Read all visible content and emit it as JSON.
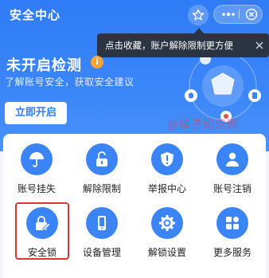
{
  "header": {
    "title": "安全中心",
    "star_icon": "star-outline-icon",
    "more_icon": "more-dots-icon",
    "close_icon": "close-circle-icon"
  },
  "tooltip": {
    "text": "点击收藏，账户解除限制更方便",
    "close_icon": "close-icon"
  },
  "status": {
    "title": "未开启检测",
    "badge": "i",
    "subtitle": "了解账号安全，获取安全建议",
    "button": "立即开启"
  },
  "watermark": "@骗子知识网",
  "services": [
    {
      "label": "账号挂失",
      "icon": "umbrella-icon"
    },
    {
      "label": "解除限制",
      "icon": "unlock-icon"
    },
    {
      "label": "举报中心",
      "icon": "report-shield-icon"
    },
    {
      "label": "账号注销",
      "icon": "user-icon"
    },
    {
      "label": "安全锁",
      "icon": "lock-pen-icon"
    },
    {
      "label": "设备管理",
      "icon": "phone-icon"
    },
    {
      "label": "解锁设置",
      "icon": "gear-icon"
    },
    {
      "label": "更多服务",
      "icon": "grid-icon"
    }
  ],
  "colors": {
    "hero": "#2f7cf6",
    "icon_bg": "#3a84f6",
    "tooltip_bg": "#2b3442",
    "highlight": "#e03434",
    "badge": "#f5a53a"
  }
}
